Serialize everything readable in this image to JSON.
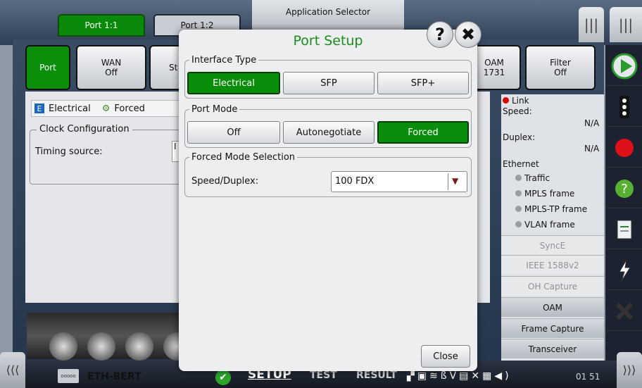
{
  "top": {
    "port_tabs": [
      "Port 1:1",
      "Port 1:2"
    ],
    "app_selector": "Application Selector"
  },
  "tiles": {
    "port": "Port",
    "wan_title": "WAN",
    "wan_value": "Off",
    "st_partial": "St",
    "oam_partial_title": "OAM",
    "oam_partial_value": "1731",
    "filter_title": "Filter",
    "filter_value": "Off"
  },
  "background": {
    "status_interface": "Electrical",
    "status_mode": "Forced",
    "clock_legend": "Clock Configuration",
    "timing_label": "Timing source:",
    "timing_value_partial": "I"
  },
  "right_panel": {
    "link_label": "Link",
    "speed_label": "Speed:",
    "speed_value": "N/A",
    "duplex_label": "Duplex:",
    "duplex_value": "N/A",
    "ethernet_label": "Ethernet",
    "indicators": [
      "Traffic",
      "MPLS frame",
      "MPLS-TP frame",
      "VLAN frame"
    ],
    "buttons_disabled": [
      "SyncE",
      "IEEE 1588v2",
      "OH Capture"
    ],
    "buttons_enabled": [
      "OAM",
      "Frame Capture",
      "Transceiver"
    ]
  },
  "dialog": {
    "title": "Port Setup",
    "help_glyph": "?",
    "close_glyph": "✖",
    "interface_type": {
      "legend": "Interface Type",
      "options": [
        "Electrical",
        "SFP",
        "SFP+"
      ],
      "selected": "Electrical"
    },
    "port_mode": {
      "legend": "Port Mode",
      "options": [
        "Off",
        "Autonegotiate",
        "Forced"
      ],
      "selected": "Forced"
    },
    "forced_mode": {
      "legend": "Forced Mode Selection",
      "speed_label": "Speed/Duplex:",
      "speed_value": "100 FDX"
    },
    "close_label": "Close"
  },
  "taskbar": {
    "left_arrow": "⟨⟨⟨",
    "right_arrow": "⟩⟩⟩",
    "app_icon_text": "ooooo",
    "app_name": "ETH-BERT",
    "tabs": [
      "SETUP",
      "TEST",
      "RESULT"
    ],
    "active_tab": "SETUP",
    "time": "01 51"
  },
  "colors": {
    "accent_green": "#0a8d0a",
    "title_green": "#1c8c1c",
    "link_red": "#d00000"
  }
}
